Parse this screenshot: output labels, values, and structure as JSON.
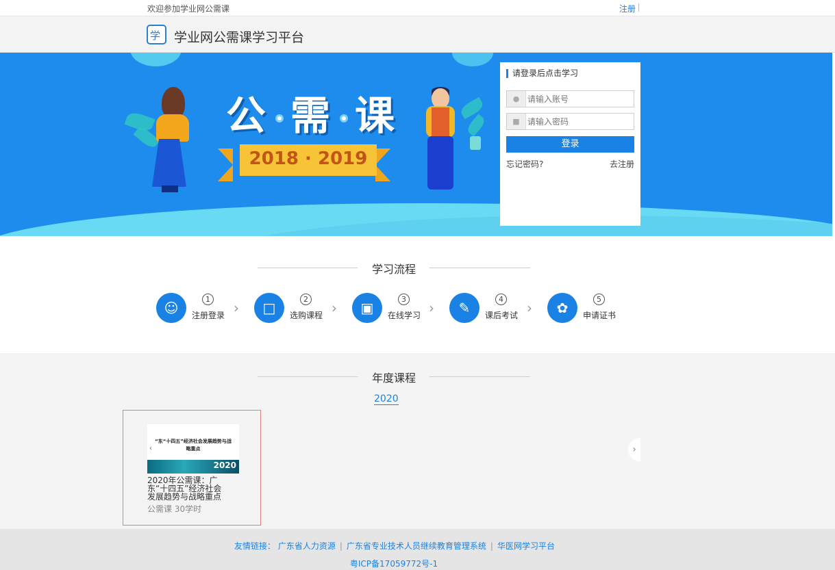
{
  "topbar": {
    "welcome": "欢迎参加学业网公需课",
    "register": "注册"
  },
  "header": {
    "logo_glyph": "学",
    "brand": "学业网公需课学习平台"
  },
  "banner": {
    "title_chars": [
      "公",
      "需",
      "课"
    ],
    "years": "2018 · 2019"
  },
  "login": {
    "title": "请登录后点击学习",
    "account_placeholder": "请输入账号",
    "password_placeholder": "请输入密码",
    "login_button": "登录",
    "forgot": "忘记密码?",
    "goto_register": "去注册"
  },
  "process": {
    "title": "学习流程",
    "steps": [
      {
        "num": "1",
        "label": "注册登录",
        "icon": "user-icon"
      },
      {
        "num": "2",
        "label": "选购课程",
        "icon": "cart-icon"
      },
      {
        "num": "3",
        "label": "在线学习",
        "icon": "monitor-icon"
      },
      {
        "num": "4",
        "label": "课后考试",
        "icon": "exam-icon"
      },
      {
        "num": "5",
        "label": "申请证书",
        "icon": "certificate-icon"
      }
    ]
  },
  "annual": {
    "title": "年度课程",
    "year_tab": "2020",
    "course": {
      "thumb_title": "“东“十四五”经济社会发展趋势与战略重点",
      "thumb_year": "2020",
      "title": "2020年公需课：广东“十四五”经济社会发展趋势与战略重点",
      "meta": "公需课 30学时"
    }
  },
  "footer": {
    "links_label": "友情链接：",
    "links": [
      "广东省人力资源",
      "广东省专业技术人员继续教育管理系统",
      "华医网学习平台"
    ],
    "icp": "粤ICP备17059772号-1"
  },
  "colors": {
    "accent": "#1a82e5",
    "banner": "#1e8ced",
    "wave": "#69daf4",
    "ribbon": "#f6c436"
  }
}
